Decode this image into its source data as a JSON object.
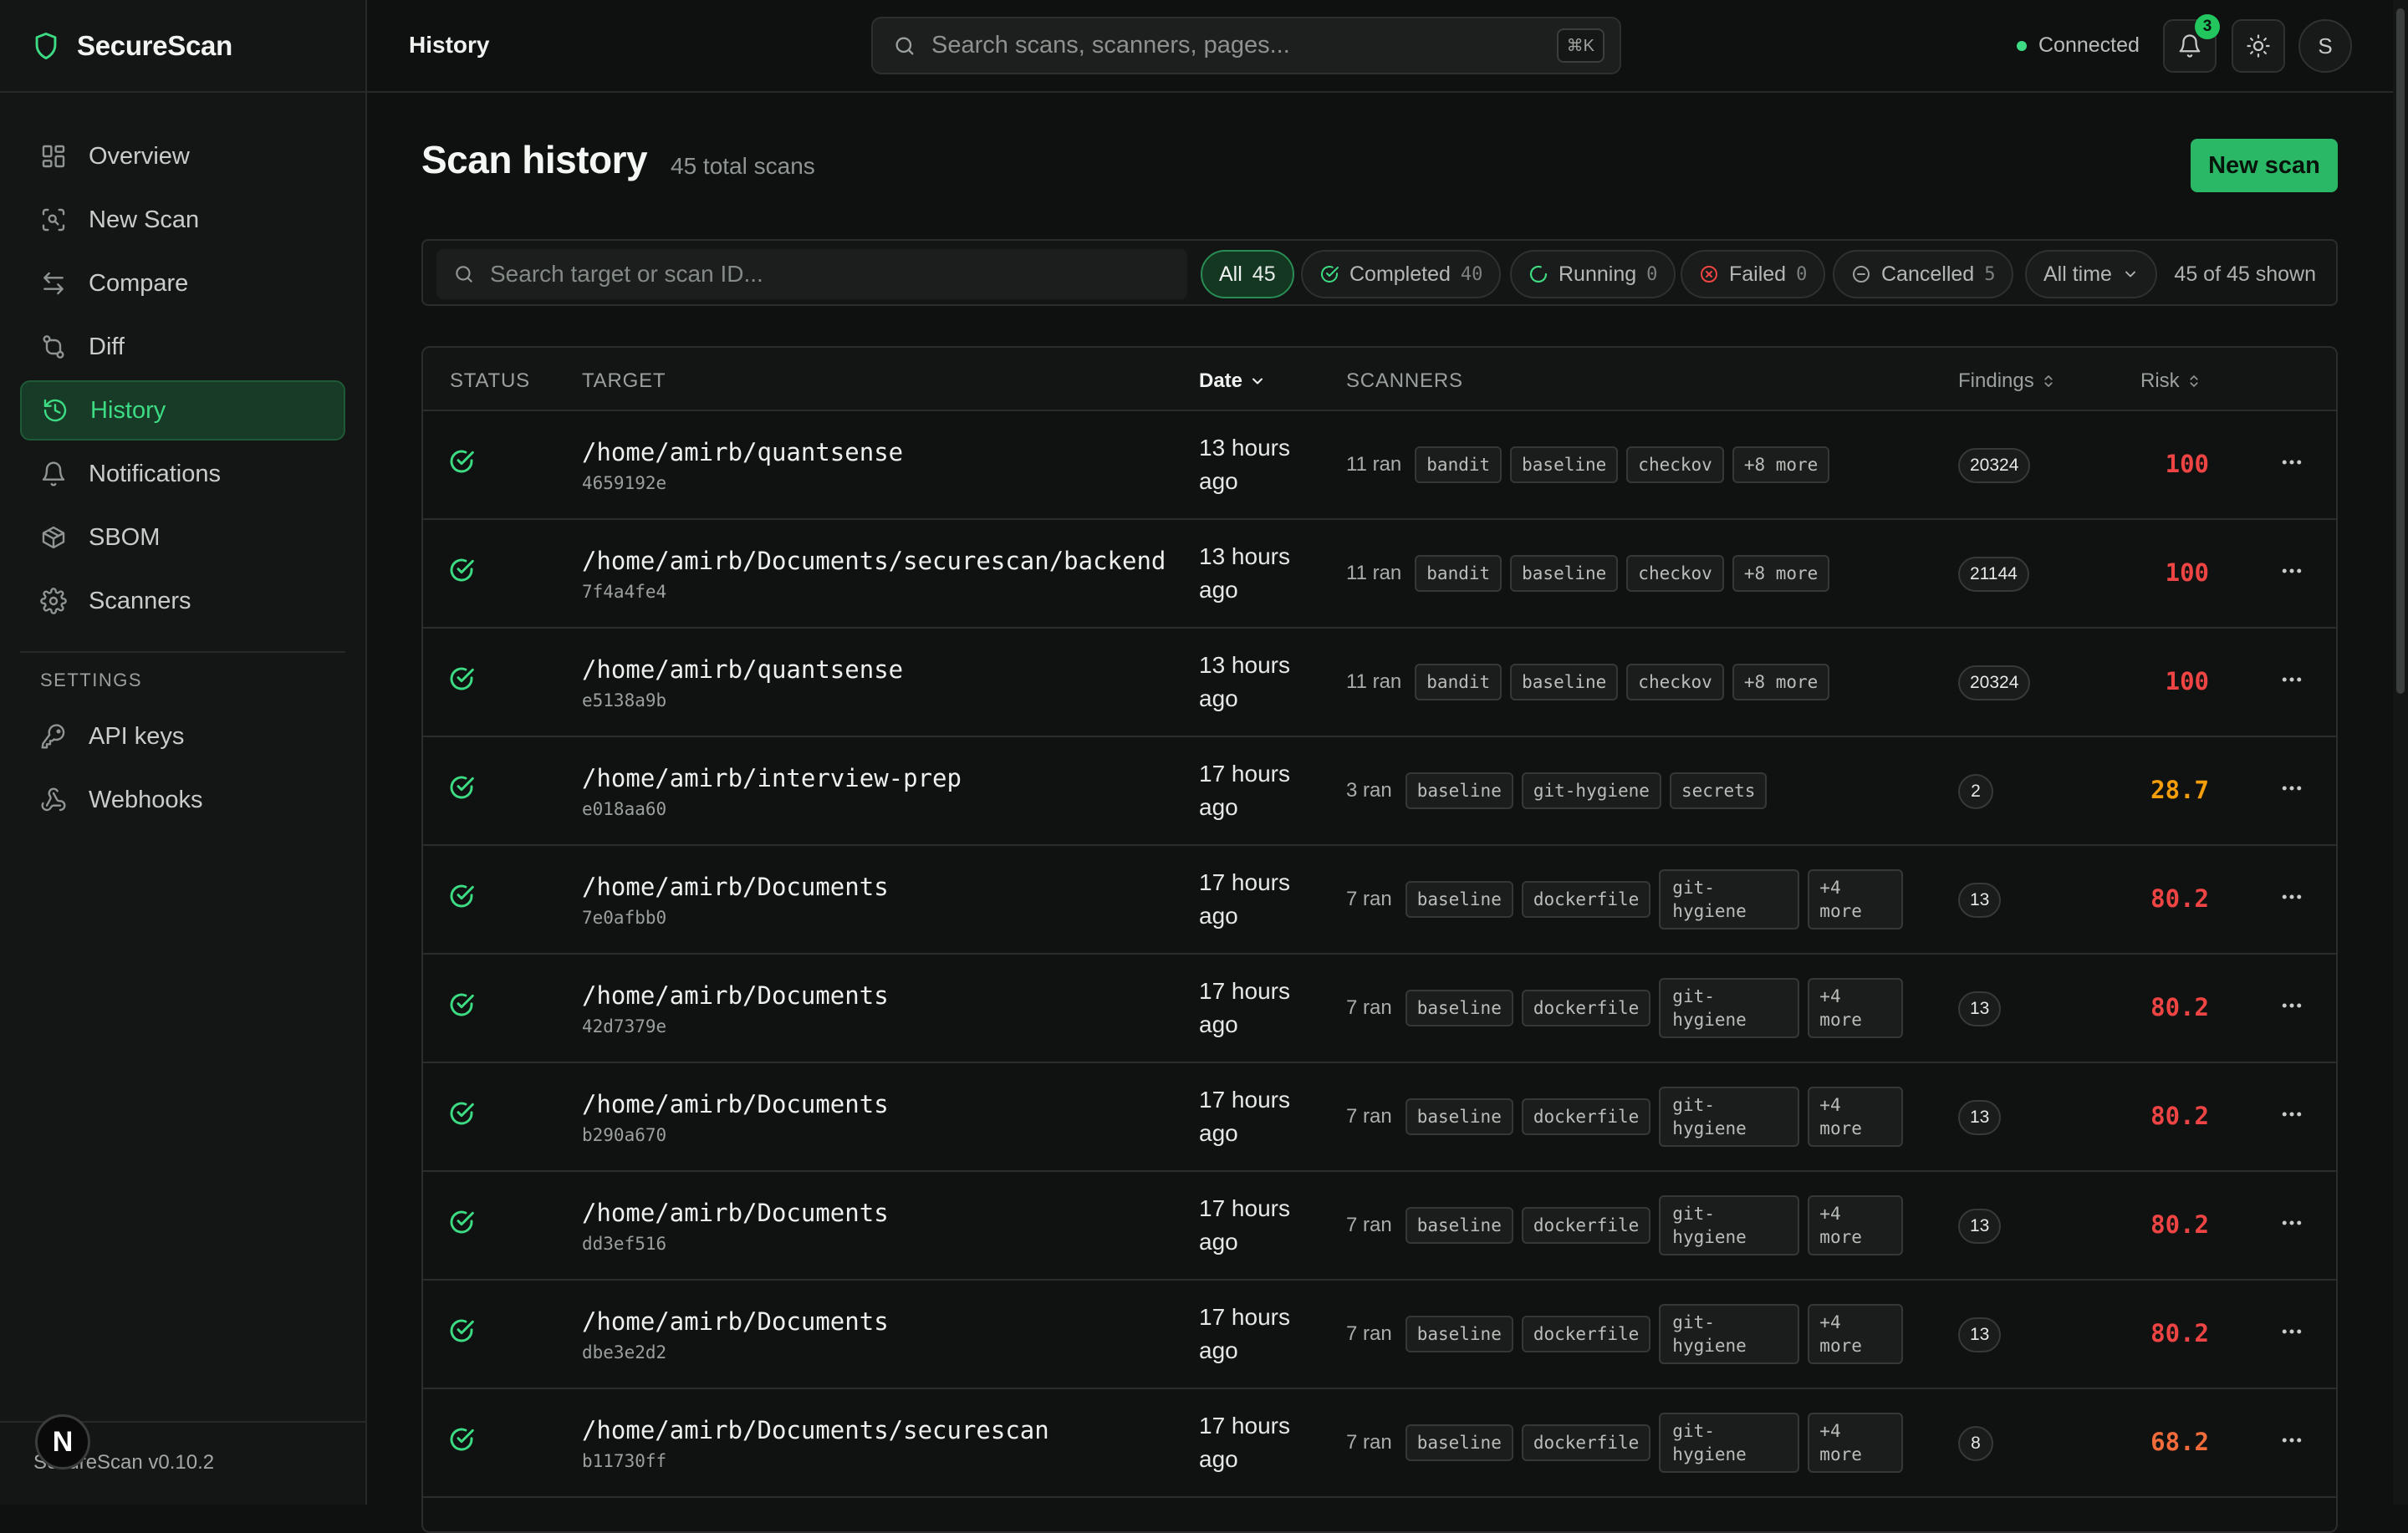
{
  "app": {
    "name": "SecureScan",
    "version": "SecureScan v0.10.2",
    "n_badge": "N"
  },
  "sidebar": {
    "items": [
      {
        "label": "Overview",
        "icon": "grid-icon"
      },
      {
        "label": "New Scan",
        "icon": "scan-icon"
      },
      {
        "label": "Compare",
        "icon": "compare-arrows-icon"
      },
      {
        "label": "Diff",
        "icon": "git-diff-icon"
      },
      {
        "label": "History",
        "icon": "history-icon",
        "active": true
      },
      {
        "label": "Notifications",
        "icon": "bell-icon"
      },
      {
        "label": "SBOM",
        "icon": "box-icon"
      },
      {
        "label": "Scanners",
        "icon": "gear-icon"
      }
    ],
    "settings_label": "SETTINGS",
    "settings_items": [
      {
        "label": "API keys",
        "icon": "key-icon"
      },
      {
        "label": "Webhooks",
        "icon": "webhook-icon"
      }
    ]
  },
  "topbar": {
    "page": "History",
    "search_placeholder": "Search scans, scanners, pages...",
    "shortcut": "⌘K",
    "status": "Connected",
    "notification_count": "3",
    "avatar": "S"
  },
  "header": {
    "title": "Scan history",
    "subtitle": "45 total scans",
    "new_scan": "New scan"
  },
  "filters": {
    "search_placeholder": "Search target or scan ID...",
    "chips": [
      {
        "label": "All",
        "count": "45",
        "active": true
      },
      {
        "label": "Completed",
        "count": "40"
      },
      {
        "label": "Running",
        "count": "0"
      },
      {
        "label": "Failed",
        "count": "0"
      },
      {
        "label": "Cancelled",
        "count": "5"
      }
    ],
    "time": "All time",
    "shown": "45 of 45 shown"
  },
  "table": {
    "columns": {
      "status": "STATUS",
      "target": "TARGET",
      "date": "Date",
      "scanners": "SCANNERS",
      "findings": "Findings",
      "risk": "Risk"
    },
    "rows": [
      {
        "path": "/home/amirb/quantsense",
        "id": "4659192e",
        "date": "13 hours ago",
        "ran": "11 ran",
        "tags": [
          "bandit",
          "baseline",
          "checkov",
          "+8 more"
        ],
        "findings": "20324",
        "risk": "100",
        "risk_color": "#ef4444"
      },
      {
        "path": "/home/amirb/Documents/securescan/backend",
        "id": "7f4a4fe4",
        "date": "13 hours ago",
        "ran": "11 ran",
        "tags": [
          "bandit",
          "baseline",
          "checkov",
          "+8 more"
        ],
        "findings": "21144",
        "risk": "100",
        "risk_color": "#ef4444"
      },
      {
        "path": "/home/amirb/quantsense",
        "id": "e5138a9b",
        "date": "13 hours ago",
        "ran": "11 ran",
        "tags": [
          "bandit",
          "baseline",
          "checkov",
          "+8 more"
        ],
        "findings": "20324",
        "risk": "100",
        "risk_color": "#ef4444"
      },
      {
        "path": "/home/amirb/interview-prep",
        "id": "e018aa60",
        "date": "17 hours ago",
        "ran": "3 ran",
        "tags": [
          "baseline",
          "git-hygiene",
          "secrets"
        ],
        "findings": "2",
        "risk": "28.7",
        "risk_color": "#f59e0b"
      },
      {
        "path": "/home/amirb/Documents",
        "id": "7e0afbb0",
        "date": "17 hours ago",
        "ran": "7 ran",
        "tags": [
          "baseline",
          "dockerfile",
          "git- hygiene",
          "+4 more"
        ],
        "findings": "13",
        "risk": "80.2",
        "risk_color": "#ef4444"
      },
      {
        "path": "/home/amirb/Documents",
        "id": "42d7379e",
        "date": "17 hours ago",
        "ran": "7 ran",
        "tags": [
          "baseline",
          "dockerfile",
          "git- hygiene",
          "+4 more"
        ],
        "findings": "13",
        "risk": "80.2",
        "risk_color": "#ef4444"
      },
      {
        "path": "/home/amirb/Documents",
        "id": "b290a670",
        "date": "17 hours ago",
        "ran": "7 ran",
        "tags": [
          "baseline",
          "dockerfile",
          "git- hygiene",
          "+4 more"
        ],
        "findings": "13",
        "risk": "80.2",
        "risk_color": "#ef4444"
      },
      {
        "path": "/home/amirb/Documents",
        "id": "dd3ef516",
        "date": "17 hours ago",
        "ran": "7 ran",
        "tags": [
          "baseline",
          "dockerfile",
          "git- hygiene",
          "+4 more"
        ],
        "findings": "13",
        "risk": "80.2",
        "risk_color": "#ef4444"
      },
      {
        "path": "/home/amirb/Documents",
        "id": "dbe3e2d2",
        "date": "17 hours ago",
        "ran": "7 ran",
        "tags": [
          "baseline",
          "dockerfile",
          "git- hygiene",
          "+4 more"
        ],
        "findings": "13",
        "risk": "80.2",
        "risk_color": "#ef4444"
      },
      {
        "path": "/home/amirb/Documents/securescan",
        "id": "b11730ff",
        "date": "17 hours ago",
        "ran": "7 ran",
        "tags": [
          "baseline",
          "dockerfile",
          "git- hygiene",
          "+4 more"
        ],
        "findings": "8",
        "risk": "68.2",
        "risk_color": "#f26b3a"
      }
    ]
  },
  "colors": {
    "accent": "#3ddc84",
    "button": "#2bb866",
    "risk_high": "#ef4444",
    "risk_mid": "#f59e0b",
    "risk_orange": "#f26b3a"
  }
}
